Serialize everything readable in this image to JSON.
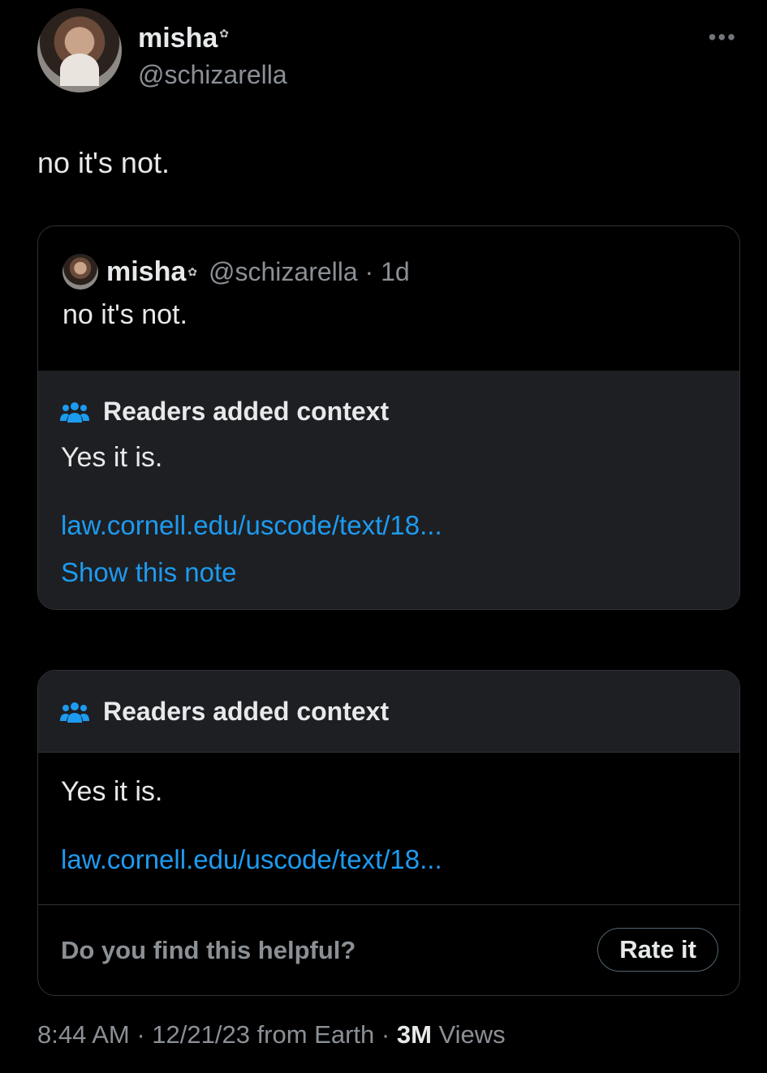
{
  "author": {
    "name": "misha",
    "badge": "✿",
    "handle": "@schizarella"
  },
  "tweet": {
    "text": "no it's not."
  },
  "quote": {
    "name": "misha",
    "badge": "✿",
    "handle_time": "@schizarella · 1d",
    "text": "no it's not.",
    "note": {
      "title": "Readers added context",
      "body": "Yes it is.",
      "link": "law.cornell.edu/uscode/text/18...",
      "show_note": "Show this note"
    }
  },
  "community_note": {
    "title": "Readers added context",
    "body": "Yes it is.",
    "link": "law.cornell.edu/uscode/text/18...",
    "helpful_prompt": "Do you find this helpful?",
    "rate_button": "Rate it"
  },
  "meta": {
    "timestamp": "8:44 AM · 12/21/23 from Earth · ",
    "views_count": "3M",
    "views_label": " Views"
  },
  "colors": {
    "background": "#000000",
    "text": "#e7e9ea",
    "secondary": "#8b9096",
    "link": "#1d9bf0",
    "note_bg": "#1e1f23"
  }
}
